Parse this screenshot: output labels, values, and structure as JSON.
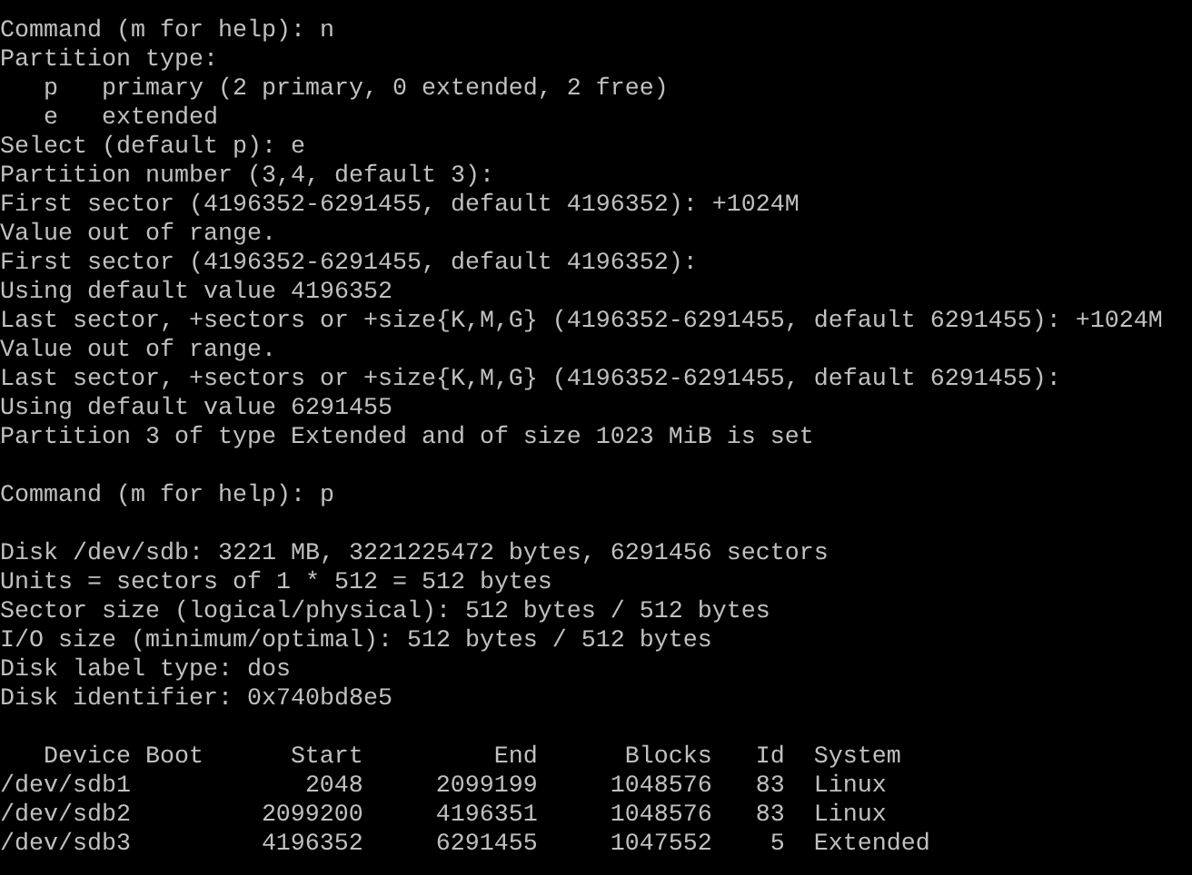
{
  "terminal": {
    "blocks": [
      {
        "lines": [
          "Command (m for help): n",
          "Partition type:",
          "   p   primary (2 primary, 0 extended, 2 free)",
          "   e   extended",
          "Select (default p): e",
          "Partition number (3,4, default 3):",
          "First sector (4196352-6291455, default 4196352): +1024M",
          "Value out of range.",
          "First sector (4196352-6291455, default 4196352):",
          "Using default value 4196352",
          "Last sector, +sectors or +size{K,M,G} (4196352-6291455, default 6291455): +1024M",
          "Value out of range.",
          "Last sector, +sectors or +size{K,M,G} (4196352-6291455, default 6291455):",
          "Using default value 6291455",
          "Partition 3 of type Extended and of size 1023 MiB is set"
        ]
      },
      {
        "lines": [
          "Command (m for help): p"
        ]
      },
      {
        "lines": [
          "Disk /dev/sdb: 3221 MB, 3221225472 bytes, 6291456 sectors",
          "Units = sectors of 1 * 512 = 512 bytes",
          "Sector size (logical/physical): 512 bytes / 512 bytes",
          "I/O size (minimum/optimal): 512 bytes / 512 bytes",
          "Disk label type: dos",
          "Disk identifier: 0x740bd8e5"
        ]
      }
    ],
    "table": {
      "columns": [
        "Device Boot",
        "Start",
        "End",
        "Blocks",
        "Id",
        "System"
      ],
      "rows": [
        [
          "/dev/sdb1",
          "2048",
          "2099199",
          "1048576",
          "83",
          "Linux"
        ],
        [
          "/dev/sdb2",
          "2099200",
          "4196351",
          "1048576",
          "83",
          "Linux"
        ],
        [
          "/dev/sdb3",
          "4196352",
          "6291455",
          "1047552",
          "5",
          "Extended"
        ]
      ]
    }
  }
}
